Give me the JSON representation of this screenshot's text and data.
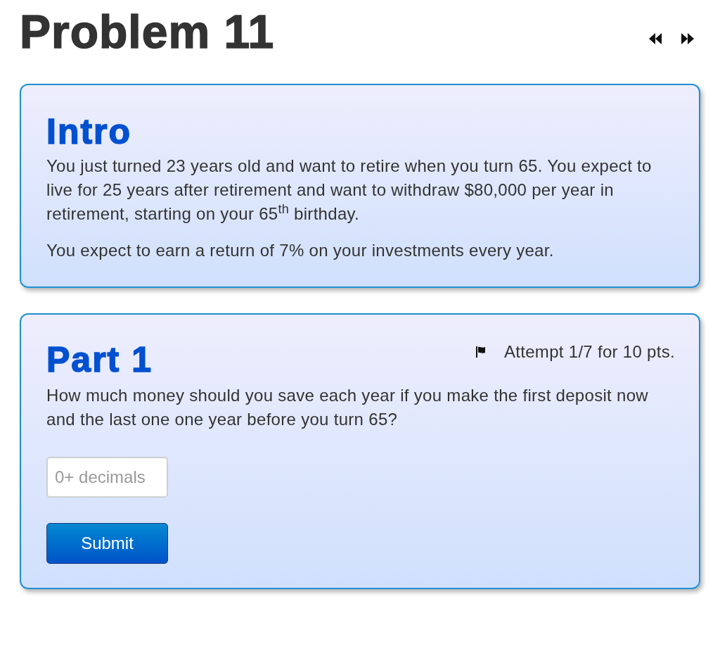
{
  "page": {
    "title": "Problem 11"
  },
  "intro": {
    "heading": "Intro",
    "paragraphs": [
      "You just turned 23 years old and want to retire when you turn 65. You expect to live for 25 years after retirement and want to withdraw $80,000 per year in retirement, starting on your 65$^{th}$ birthday.",
      "You expect to earn a return of 7% on your investments every year."
    ]
  },
  "parts": [
    {
      "heading": "Part 1",
      "attempt": "Attempt 1/7 for 10 pts.",
      "question": "How much money should you save each year if you make the first deposit now and the last one one year before you turn 65?",
      "answer": {
        "placeholder": "0+ decimals"
      },
      "submit": "Submit"
    }
  ]
}
